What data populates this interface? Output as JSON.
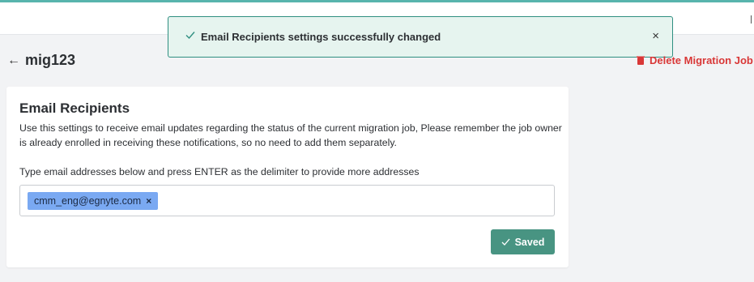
{
  "toast": {
    "message": "Email Recipients settings successfully changed",
    "close_glyph": "×",
    "icon": "check-icon"
  },
  "page": {
    "back_glyph": "←",
    "job_title": "mig123",
    "delete_label": "Delete Migration Job"
  },
  "card": {
    "title": "Email Recipients",
    "description": "Use this settings to receive email updates regarding the status of the current migration job, Please remember the job owner is already enrolled in receiving these notifications, so no need to add them separately.",
    "instruction": "Type email addresses below and press ENTER as the delimiter to provide more addresses",
    "emails": [
      "cmm_eng@egnyte.com"
    ],
    "chip_remove_glyph": "×",
    "saved_label": "Saved"
  },
  "colors": {
    "accent": "#58b4ad",
    "toast_bg": "#e6f4ef",
    "toast_border": "#2f8f81",
    "danger": "#d93737",
    "chip": "#7aa9f2",
    "saved_button": "#3f8f7c"
  }
}
